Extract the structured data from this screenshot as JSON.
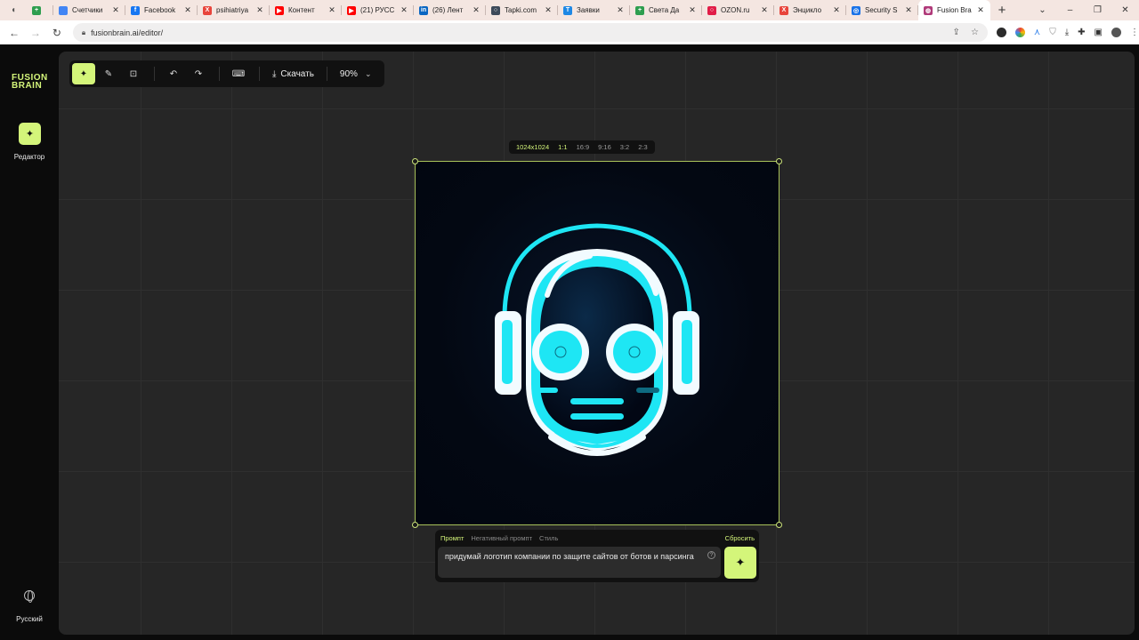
{
  "browser": {
    "tabs": [
      {
        "label": "",
        "color": "#2e9e4f",
        "glyph": "+"
      },
      {
        "label": "Счетчики",
        "color": "#4285f4",
        "glyph": ""
      },
      {
        "label": "Facebook",
        "color": "#1877f2",
        "glyph": "f"
      },
      {
        "label": "psihiatriya",
        "color": "#e8453c",
        "glyph": "X"
      },
      {
        "label": "Контент",
        "color": "#ff0000",
        "glyph": "▶"
      },
      {
        "label": "(21) РУСС",
        "color": "#ff0000",
        "glyph": "▶"
      },
      {
        "label": "(26) Лент",
        "color": "#0a66c2",
        "glyph": "in"
      },
      {
        "label": "Tapki.com",
        "color": "#3d4a5a",
        "glyph": "○"
      },
      {
        "label": "Заявки",
        "color": "#1e88e5",
        "glyph": "T"
      },
      {
        "label": "Света Да",
        "color": "#2e9e4f",
        "glyph": "+"
      },
      {
        "label": "OZON.ru",
        "color": "#e11d48",
        "glyph": "○"
      },
      {
        "label": "Энцикло",
        "color": "#e8453c",
        "glyph": "X"
      },
      {
        "label": "Security S",
        "color": "#1a73e8",
        "glyph": "◎"
      },
      {
        "label": "Fusion Bra",
        "color": "#b03a7a",
        "glyph": "◍"
      }
    ],
    "url": "fusionbrain.ai/editor/"
  },
  "sidebar": {
    "logo_line1": "FUSION",
    "logo_line2": "BRAIN",
    "editor_label": "Редактор",
    "language": "Русский"
  },
  "toolbar": {
    "download_label": "Скачать",
    "zoom": "90%"
  },
  "ratio": {
    "size": "1024x1024",
    "options": [
      "1:1",
      "16:9",
      "9:16",
      "3:2",
      "2:3"
    ],
    "selected": "1:1"
  },
  "prompt": {
    "tabs": [
      "Промпт",
      "Негативный промпт",
      "Стиль"
    ],
    "active_tab": "Промпт",
    "reset_label": "Сбросить",
    "text": "придумай логотип компании по защите сайтов от ботов и парсинга"
  },
  "colors": {
    "accent": "#d4f57a",
    "cyan": "#1ee6f4",
    "canvas_bg": "#262626"
  }
}
